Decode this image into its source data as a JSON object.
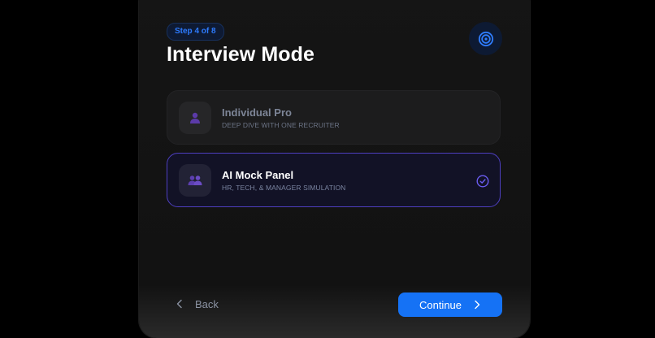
{
  "step_badge": "Step 4 of 8",
  "title": "Interview Mode",
  "header_icon": "target-icon",
  "options": [
    {
      "title": "Individual Pro",
      "subtitle": "DEEP DIVE WITH ONE RECRUITER",
      "icon": "user-icon",
      "selected": false
    },
    {
      "title": "AI Mock Panel",
      "subtitle": "HR, TECH, & MANAGER SIMULATION",
      "icon": "users-icon",
      "selected": true
    }
  ],
  "footer": {
    "back_label": "Back",
    "continue_label": "Continue"
  },
  "colors": {
    "accent_blue": "#1572f5",
    "selected_border": "#4e3fc0",
    "icon_purple": "#6b3fc9"
  }
}
